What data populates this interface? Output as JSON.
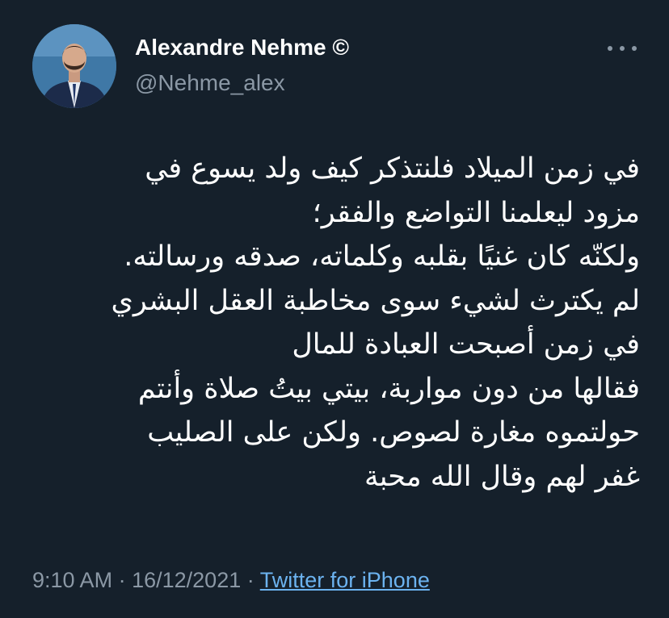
{
  "author": {
    "display_name": "Alexandre Nehme",
    "badge": "©",
    "handle": "@Nehme_alex",
    "avatar_icon": "profile-photo"
  },
  "more_icon": "more-horizontal-icon",
  "tweet": {
    "lines": [
      "في زمن الميلاد فلنتذكر كيف ولد يسوع في",
      "مزود ليعلمنا التواضع والفقر؛",
      "ولكنّه كان غنيًا بقلبه وكلماته، صدقه ورسالته.",
      "لم يكترث لشيء سوى مخاطبة العقل البشري",
      "في زمن أصبحت العبادة للمال",
      "فقالها من دون مواربة، بيتي بيتُ صلاة وأنتم",
      "حولتموه مغارة لصوص. ولكن على الصليب",
      "غفر لهم وقال الله محبة"
    ]
  },
  "meta": {
    "time": "9:10 AM",
    "separator": "·",
    "date": "16/12/2021",
    "source": "Twitter for iPhone"
  },
  "colors": {
    "background": "#15202b",
    "text": "#ffffff",
    "secondary": "#8b98a5",
    "link": "#6cb3f0"
  }
}
